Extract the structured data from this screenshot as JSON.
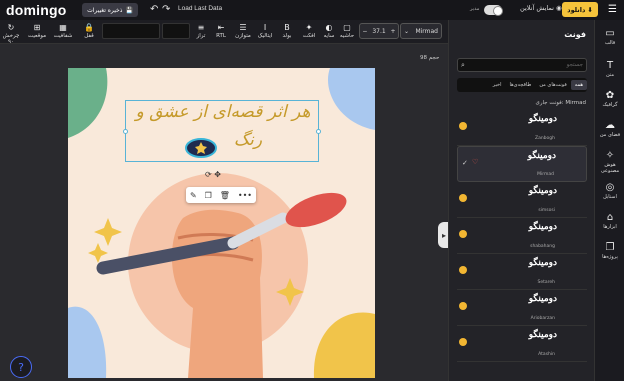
{
  "app": {
    "logo": "domingo"
  },
  "topbar": {
    "save_label": "ذخیره تغییرات",
    "undo_icon": "undo-icon",
    "redo_icon": "redo-icon",
    "load_label": "Load Last Data",
    "toggle_label": "مدیر",
    "preview_label": "نمایش آنلاین",
    "download_label": "دانلود"
  },
  "toolbar": {
    "tools": [
      {
        "label": "چرخش ۹۰",
        "icon": "↻"
      },
      {
        "label": "موقعیت",
        "icon": "⊞"
      },
      {
        "label": "شفافیت",
        "icon": "▦"
      },
      {
        "label": "قفل",
        "icon": "🔒"
      },
      {
        "label": "تراز",
        "icon": "≡"
      },
      {
        "label": "RTL",
        "icon": "⇤"
      },
      {
        "label": "متوازن",
        "icon": "☰"
      },
      {
        "label": "ایتالیک",
        "icon": "I"
      },
      {
        "label": "بولد",
        "icon": "B"
      },
      {
        "label": "افکت",
        "icon": "✦"
      },
      {
        "label": "سایه",
        "icon": "◐"
      },
      {
        "label": "حاشیه",
        "icon": "▢"
      },
      {
        "label": "رنگ",
        "icon": "●"
      }
    ],
    "font_size": "37.1",
    "font_name": "Mirmad"
  },
  "workspace": {
    "zoom_label": "حجم 98",
    "help_icon": "?"
  },
  "panel": {
    "title": "فونت",
    "search_placeholder": "جستجو",
    "tabs": [
      "همه",
      "فونت‌های من",
      "طاقچه‌ی‌ها",
      "اخیر"
    ],
    "current_label": "فونت جاری: Mirmad",
    "fonts": [
      {
        "sample": "دومینگو",
        "name": "Zanbogh"
      },
      {
        "sample": "دومینگو",
        "name": "Mirmad"
      },
      {
        "sample": "دومینگو",
        "name": "simsosi"
      },
      {
        "sample": "دومینگو",
        "name": "shabahang"
      },
      {
        "sample": "دومینگو",
        "name": "Setareh"
      },
      {
        "sample": "دومینگو",
        "name": "Ariobarzan"
      },
      {
        "sample": "دومینگو",
        "name": "Atashin"
      }
    ]
  },
  "rail": {
    "items": [
      {
        "label": "قالب",
        "icon": "▭"
      },
      {
        "label": "متن",
        "icon": "T"
      },
      {
        "label": "گرافیک",
        "icon": "✿"
      },
      {
        "label": "فضای من",
        "icon": "☁"
      },
      {
        "label": "هوش مصنوعی",
        "icon": "✧"
      },
      {
        "label": "استایل",
        "icon": "◎"
      },
      {
        "label": "ابزارها",
        "icon": "⌂"
      },
      {
        "label": "پروژه‌ها",
        "icon": "❐"
      }
    ]
  },
  "canvas": {
    "headline_line1": "هر اثر قصه‌ای از عشق و",
    "headline_line2": "رنگ"
  },
  "colors": {
    "accent": "#4a6cf7",
    "download": "#f5c33b",
    "canvas_bg": "#f9e9da"
  }
}
